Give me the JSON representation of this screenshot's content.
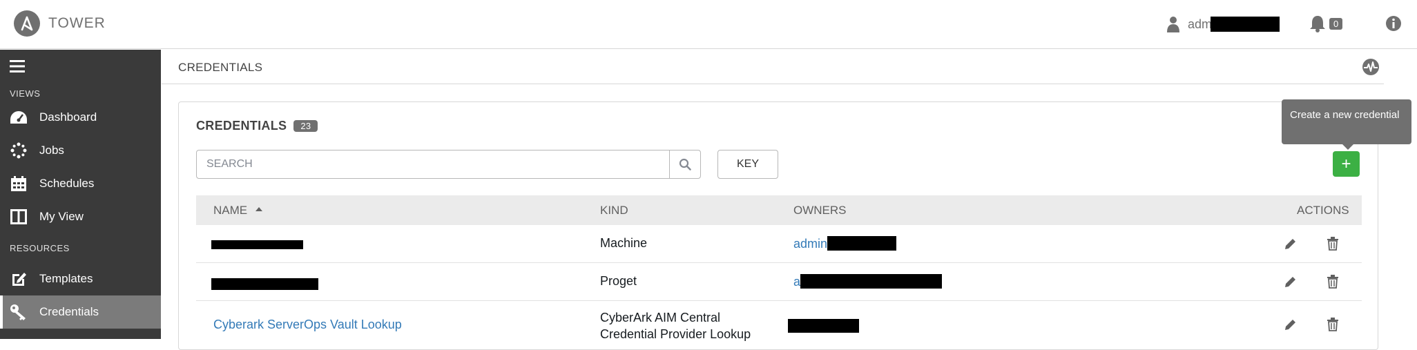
{
  "app": {
    "brand": "TOWER"
  },
  "header": {
    "user_name": "adm",
    "notification_count": "0"
  },
  "sidebar": {
    "views_label": "VIEWS",
    "resources_label": "RESOURCES",
    "items": [
      {
        "label": "Dashboard",
        "icon": "dashboard-icon"
      },
      {
        "label": "Jobs",
        "icon": "spinner-icon"
      },
      {
        "label": "Schedules",
        "icon": "calendar-icon"
      },
      {
        "label": "My View",
        "icon": "columns-icon"
      },
      {
        "label": "Templates",
        "icon": "pencil-square-icon"
      },
      {
        "label": "Credentials",
        "icon": "key-icon",
        "active": true
      }
    ]
  },
  "page": {
    "title": "CREDENTIALS"
  },
  "panel": {
    "title": "CREDENTIALS",
    "count": "23",
    "search_placeholder": "SEARCH",
    "key_label": "KEY",
    "add_label": "+",
    "add_tooltip": "Create a new credential"
  },
  "table": {
    "columns": {
      "name": "NAME",
      "kind": "KIND",
      "owners": "OWNERS",
      "actions": "ACTIONS"
    },
    "rows": [
      {
        "name": "",
        "kind": "Machine",
        "owner": "admin"
      },
      {
        "name": "",
        "kind": "Proget",
        "owner": "a"
      },
      {
        "name": "Cyberark ServerOps Vault Lookup",
        "kind": "CyberArk AIM Central Credential Provider Lookup",
        "owner": ""
      }
    ]
  },
  "colors": {
    "sidebar_bg": "#3a3a3a",
    "sidebar_active": "#7b7b7b",
    "add_button": "#3cb044",
    "link": "#337ab7",
    "tooltip": "#707070"
  }
}
